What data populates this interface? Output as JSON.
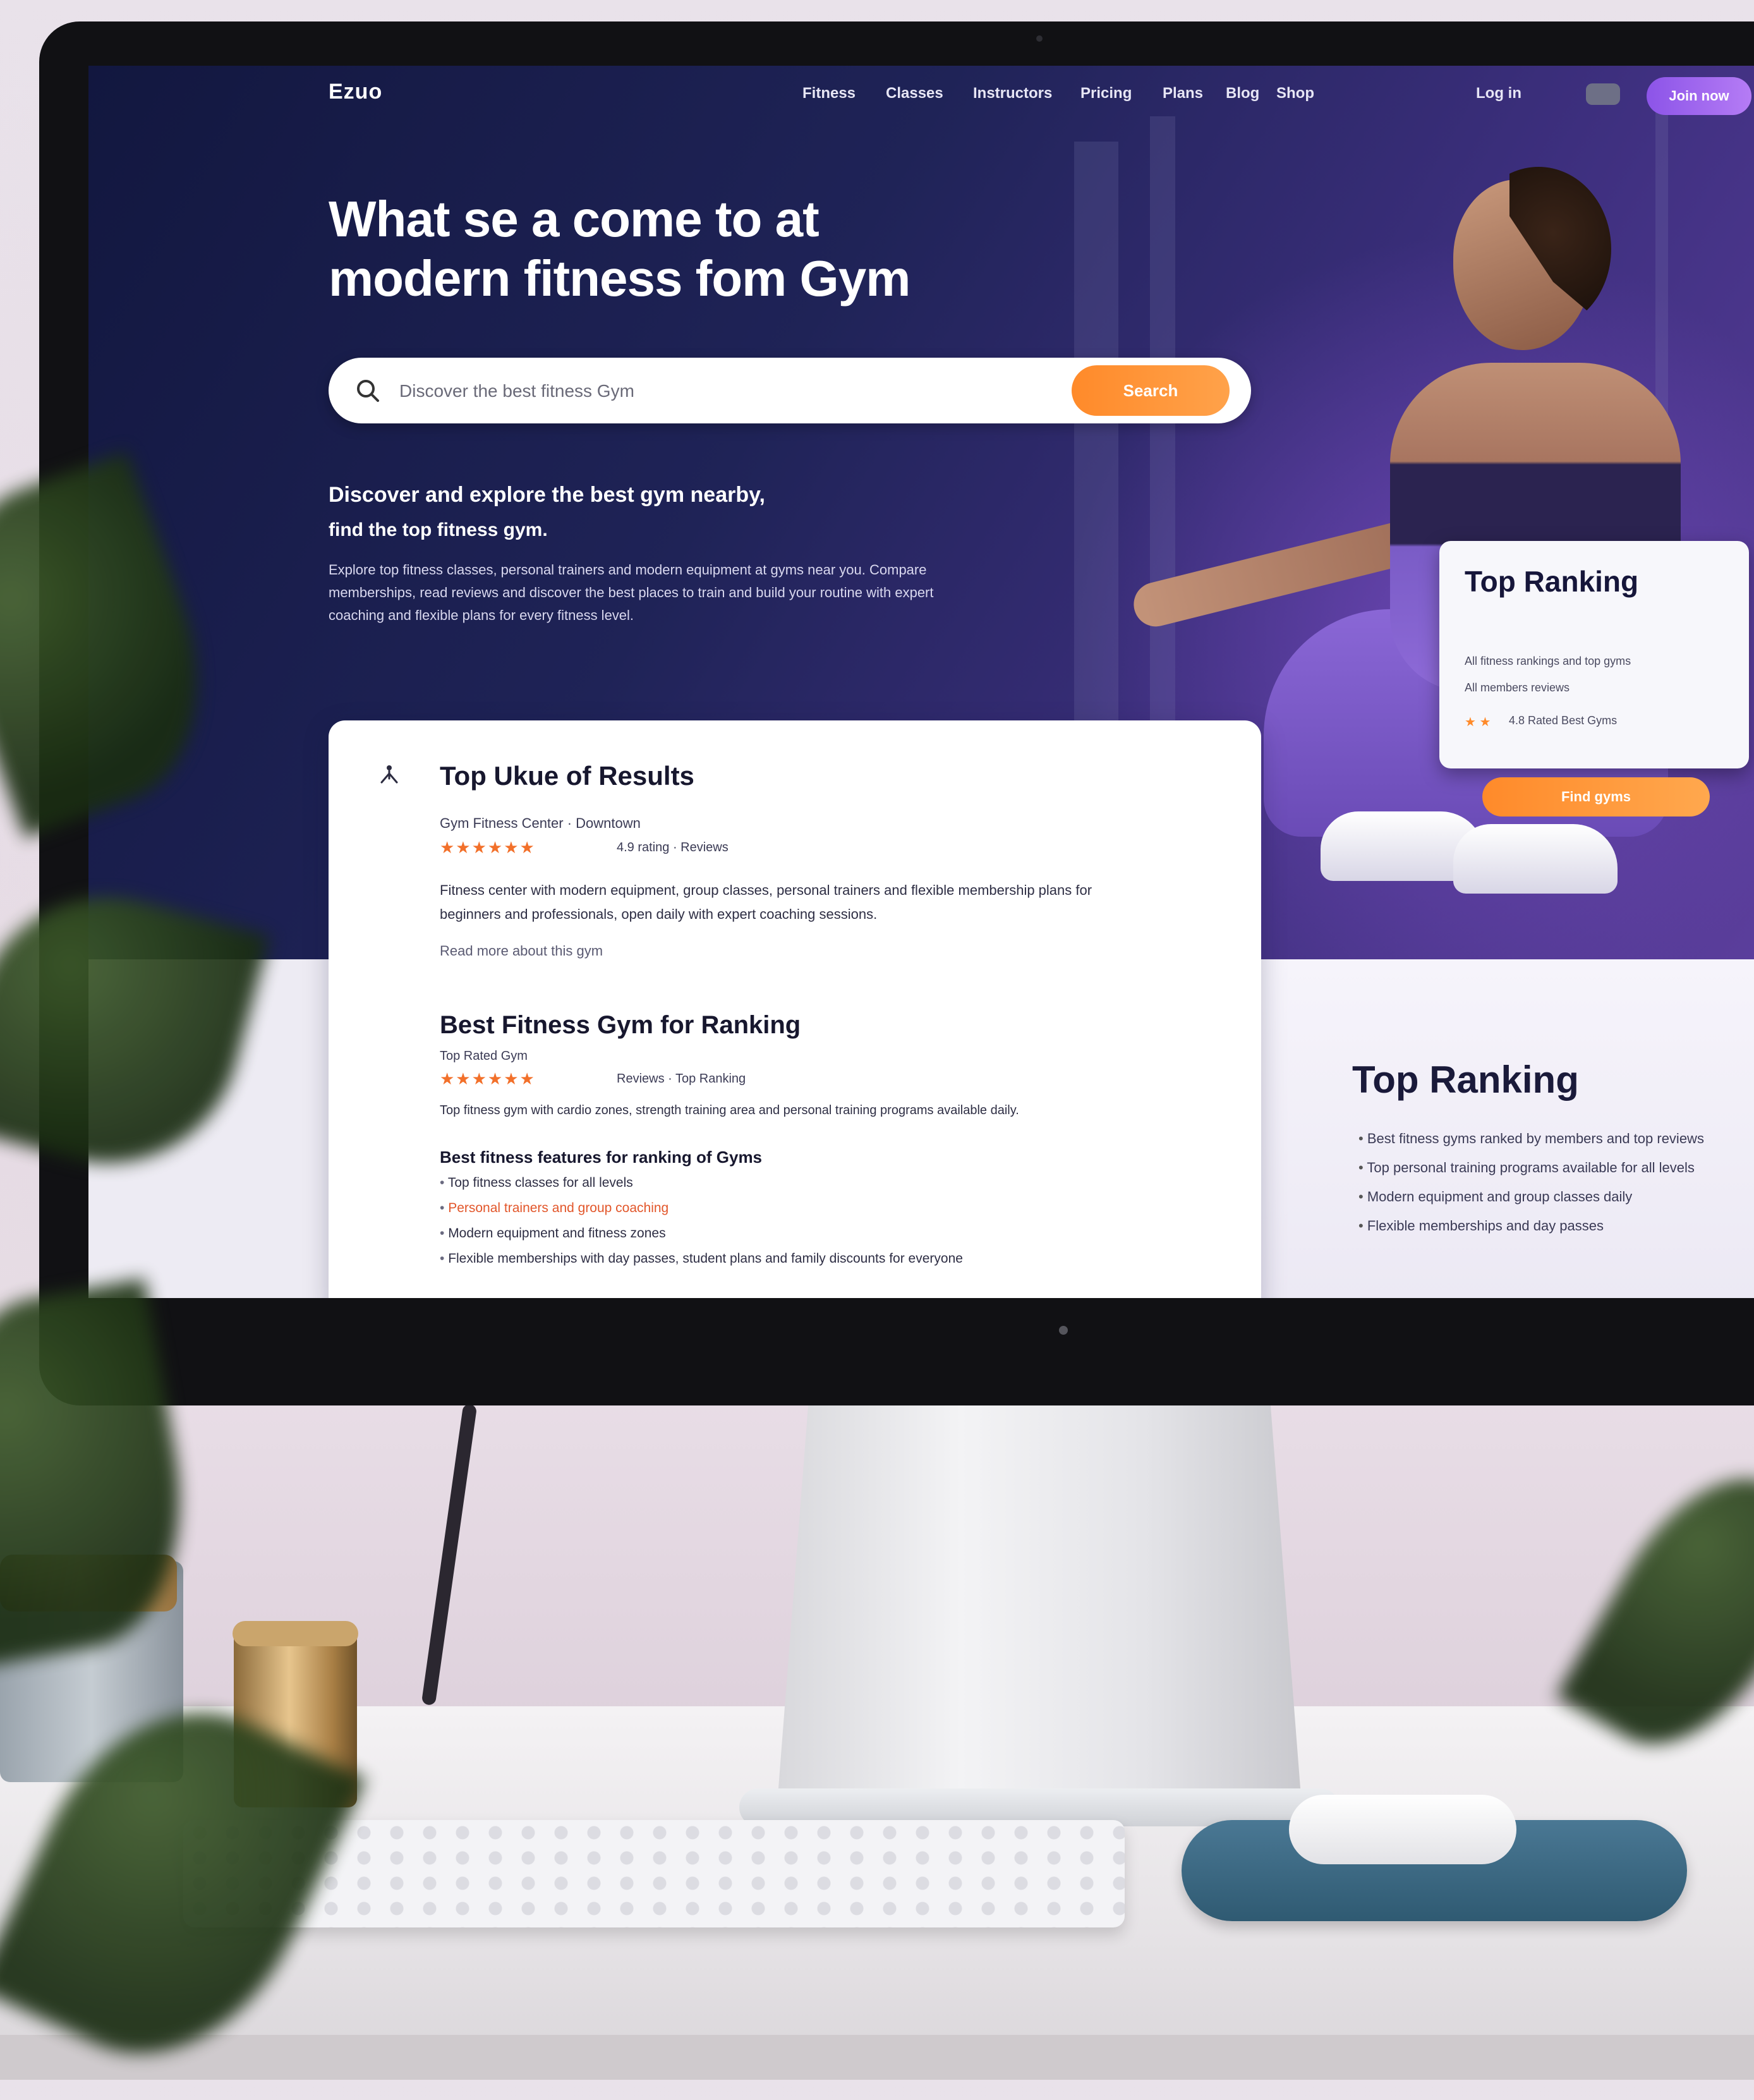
{
  "nav": {
    "logo": "Ezuo",
    "items": [
      "Fitness",
      "Classes",
      "Instructors",
      "Pricing",
      "Plans",
      "Blog",
      "Shop"
    ],
    "login": "Log in",
    "cta": "Join now"
  },
  "hero": {
    "title_line1": "What se a come to at",
    "title_line2": "modern fitness fom Gym",
    "subheading1": "Discover and explore the best gym nearby,",
    "subheading2": "find the top fitness gym.",
    "body": "Explore top fitness classes, personal trainers and modern equipment at gyms near you. Compare memberships, read reviews and discover the best places to train and build your routine with expert coaching and flexible plans for every fitness level."
  },
  "search": {
    "placeholder": "Discover the best fitness Gym",
    "button_label": "Search"
  },
  "rank_card": {
    "title": "Top Ranking",
    "line1": "All fitness rankings and top gyms",
    "line2": "All members reviews",
    "stars": "★ ★",
    "stars_text": "4.8 Rated  Best Gyms",
    "button_label": "Find gyms"
  },
  "results": {
    "heading": "Top Ukue of Results",
    "item1": {
      "meta": "Gym Fitness Center · Downtown",
      "stars": "★★★★★★",
      "rating_text": "4.9 rating · Reviews",
      "text1": "Fitness center with modern equipment, group classes, personal trainers and flexible membership plans for",
      "text2": "beginners and professionals, open daily with expert coaching sessions.",
      "link": "Read more about this gym"
    },
    "item2": {
      "title": "Best Fitness Gym for Ranking",
      "meta": "Top Rated Gym",
      "stars": "★★★★★★",
      "rating_text": "Reviews · Top Ranking",
      "text": "Top fitness gym with cardio zones, strength training area and personal training programs available daily."
    },
    "subheading": "Best fitness features for ranking of Gyms",
    "list": [
      {
        "text": "Top fitness classes for all levels",
        "accent": ""
      },
      {
        "text": "Personal trainers and group coaching",
        "accent": "orange"
      },
      {
        "text": "Modern equipment and fitness zones",
        "accent": ""
      },
      {
        "text": "Flexible memberships with day passes, student plans and family discounts for everyone",
        "accent": ""
      }
    ]
  },
  "right": {
    "title": "Top Ranking",
    "items": [
      "Best fitness gyms ranked by members and top reviews",
      "Top personal training programs available for all levels",
      "Modern equipment and group classes daily",
      "Flexible memberships and day passes"
    ]
  }
}
